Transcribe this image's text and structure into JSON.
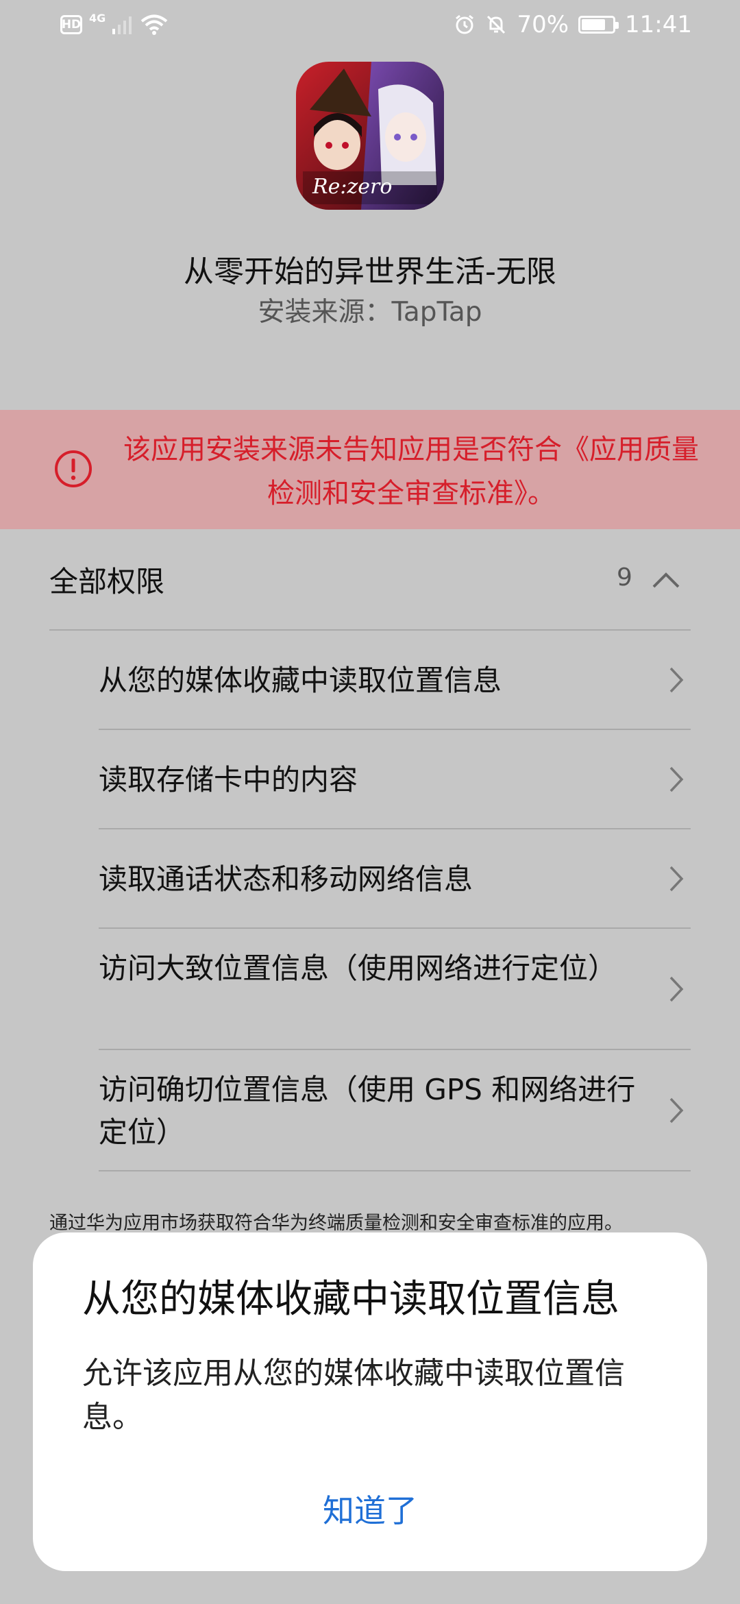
{
  "status_bar": {
    "hd": "HD",
    "network": "4G",
    "battery": "70%",
    "time": "11:41",
    "icons": [
      "signal-icon",
      "wifi-icon",
      "alarm-icon",
      "mute-icon",
      "battery-icon"
    ]
  },
  "app": {
    "name": "从零开始的异世界生活-无限",
    "install_source": "安装来源：TapTap",
    "icon_text": "Re:zero"
  },
  "warning": {
    "text": "该应用安装来源未告知应用是否符合《应用质量检测和安全审查标准》。",
    "color": "#d61e2a"
  },
  "permissions": {
    "header": "全部权限",
    "count": "9",
    "items": [
      "从您的媒体收藏中读取位置信息",
      "读取存储卡中的内容",
      "读取通话状态和移动网络信息",
      "访问大致位置信息（使用网络进行定位）",
      "访问确切位置信息（使用 GPS 和网络进行定位）"
    ],
    "footnote": "通过华为应用市场获取符合华为终端质量检测和安全审查标准的应用。"
  },
  "dialog": {
    "title": "从您的媒体收藏中读取位置信息",
    "body": "允许该应用从您的媒体收藏中读取位置信息。",
    "button": "知道了",
    "accent": "#1f6fd6"
  },
  "overlay_color": "#c6c6c6"
}
